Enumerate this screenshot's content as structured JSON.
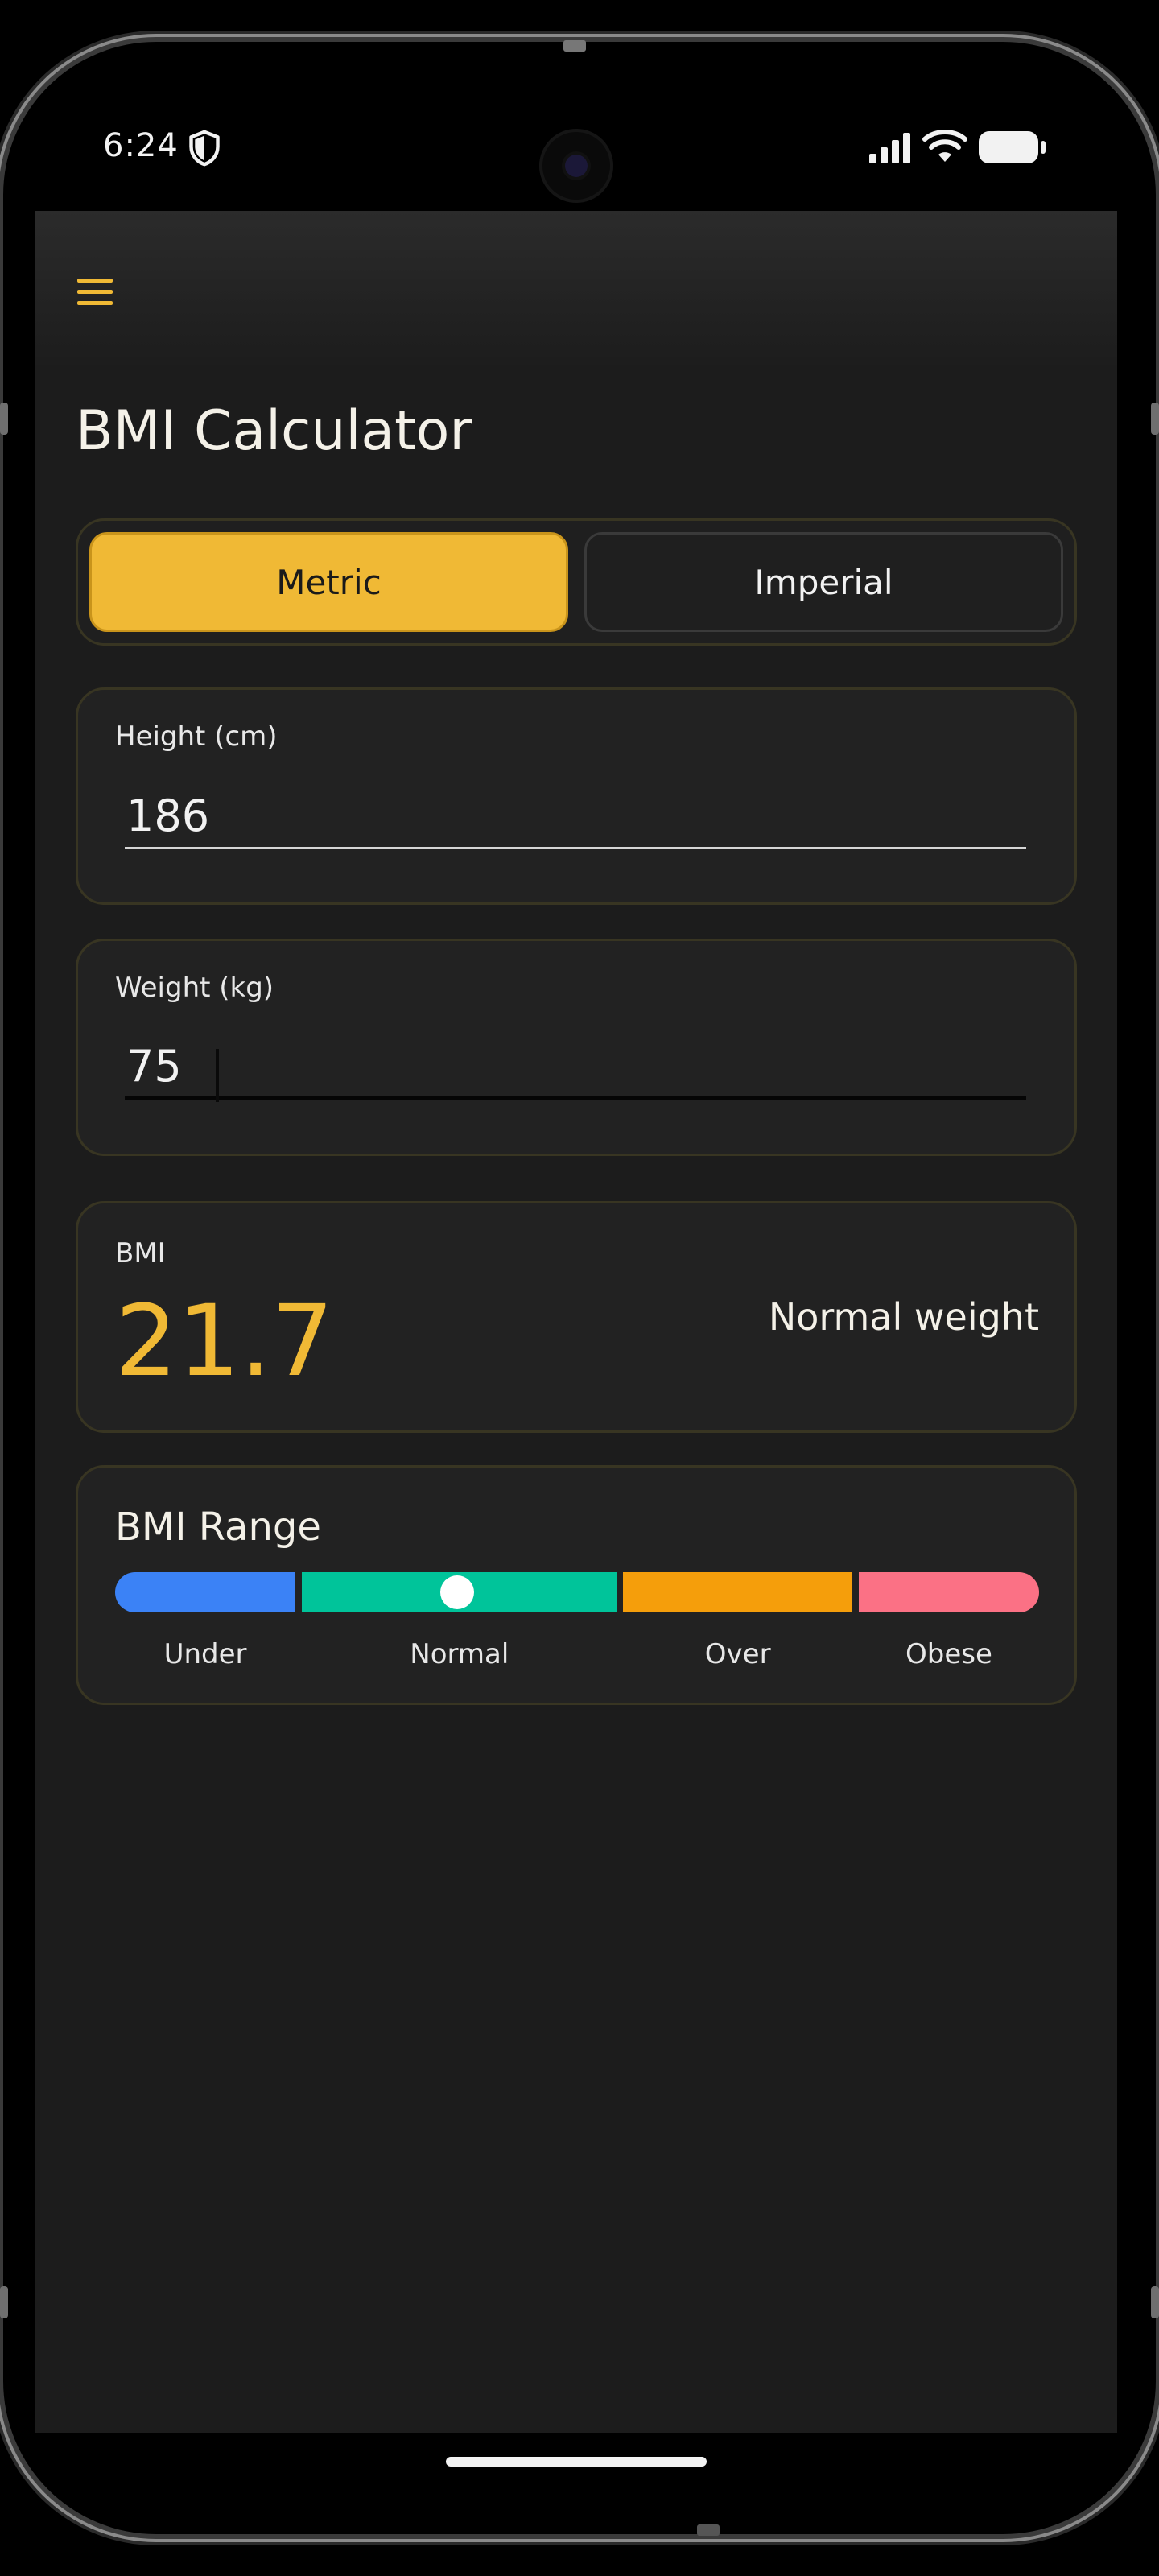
{
  "status_bar": {
    "time": "6:24"
  },
  "app": {
    "title": "BMI Calculator",
    "menu_icon": "hamburger-menu-icon",
    "accent_color": "#f0b935"
  },
  "units": {
    "options": [
      "Metric",
      "Imperial"
    ],
    "selected": "Metric"
  },
  "height_field": {
    "label": "Height (cm)",
    "value": "186"
  },
  "weight_field": {
    "label": "Weight (kg)",
    "value": "75"
  },
  "result": {
    "label": "BMI",
    "value": "21.7",
    "category": "Normal weight"
  },
  "range": {
    "title": "BMI Range",
    "marker_position_fraction": 0.37,
    "segments": [
      {
        "label": "Under",
        "color": "#3b82f6",
        "fraction": 0.197
      },
      {
        "label": "Normal",
        "color": "#00c49a",
        "fraction": 0.344
      },
      {
        "label": "Over",
        "color": "#f59e0b",
        "fraction": 0.25
      },
      {
        "label": "Obese",
        "color": "#fb7185",
        "fraction": 0.197
      }
    ]
  }
}
